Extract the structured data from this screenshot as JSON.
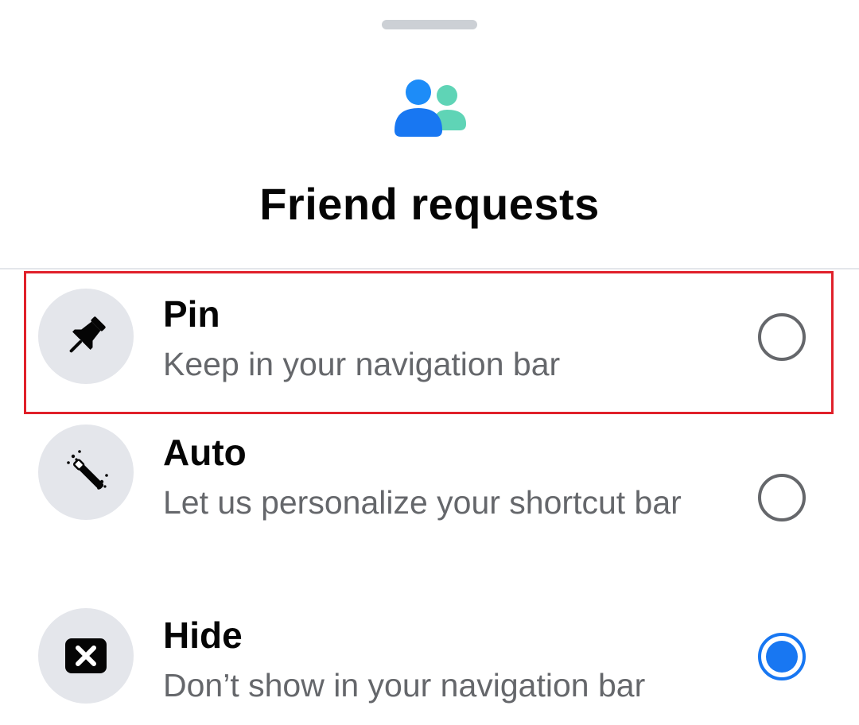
{
  "sheet": {
    "title": "Friend requests"
  },
  "options": [
    {
      "label": "Pin",
      "description": "Keep in your navigation bar",
      "icon": "pin-icon",
      "selected": false
    },
    {
      "label": "Auto",
      "description": "Let us personalize your shortcut bar",
      "icon": "magic-wand-icon",
      "selected": false
    },
    {
      "label": "Hide",
      "description": "Don’t show in your navigation bar",
      "icon": "hide-x-icon",
      "selected": true
    }
  ],
  "colors": {
    "accent": "#1877f2",
    "highlight_border": "#e0202a",
    "icon_bg": "#e4e6eb",
    "secondary_text": "#65676b"
  }
}
